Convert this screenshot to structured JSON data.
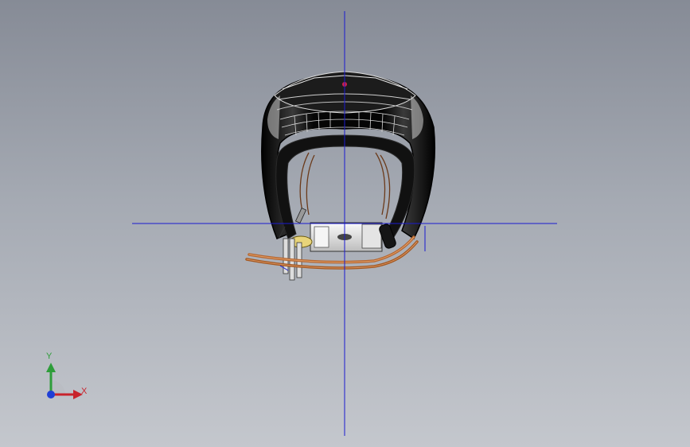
{
  "viewport": {
    "background_top": "#868b96",
    "background_bottom": "#c4c7cd"
  },
  "origin_lines": {
    "color": "#1a1ad0"
  },
  "model": {
    "body_color": "#0a0a0a",
    "highlight_color": "#e8e8e8",
    "cable_color": "#b5652f",
    "marker_color": "#d0204a"
  },
  "triad": {
    "x_label": "X",
    "y_label": "Y",
    "x_color": "#c8232c",
    "y_color": "#2e9d3a",
    "z_color": "#1f3fd6",
    "icons": [
      "x-axis-arrow-icon",
      "y-axis-arrow-icon",
      "z-axis-origin-icon"
    ]
  }
}
